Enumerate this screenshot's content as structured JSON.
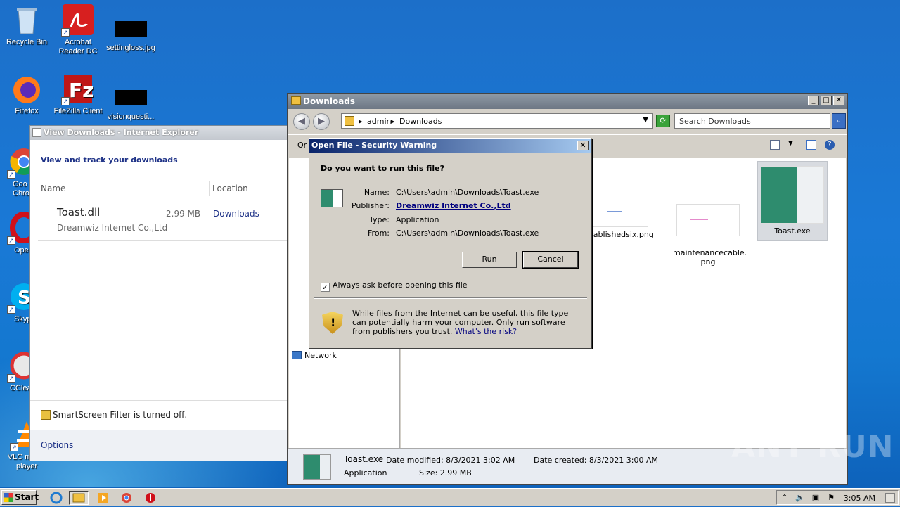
{
  "desktop": {
    "icons": [
      {
        "label": "Recycle Bin"
      },
      {
        "label": "Acrobat Reader DC"
      },
      {
        "label": "settingloss.jpg"
      },
      {
        "label": "Firefox"
      },
      {
        "label": "FileZilla Client"
      },
      {
        "label": "visionquesti..."
      },
      {
        "label": "Goo Chro"
      },
      {
        "label": "Ope"
      },
      {
        "label": "Skyp"
      },
      {
        "label": "CClea"
      },
      {
        "label": "VLC media player"
      }
    ]
  },
  "ie_window": {
    "title": "View Downloads - Internet Explorer",
    "heading": "View and track your downloads",
    "col_name": "Name",
    "col_location": "Location",
    "item": {
      "name": "Toast.dll",
      "size": "2.99 MB",
      "location": "Downloads",
      "publisher": "Dreamwiz Internet Co.,Ltd"
    },
    "smartscreen": "SmartScreen Filter is turned off.",
    "options": "Options"
  },
  "explorer": {
    "title": "Downloads",
    "breadcrumb": [
      "admin",
      "Downloads"
    ],
    "search_placeholder": "Search Downloads",
    "organize_partial": "Or",
    "network": "Network",
    "files": [
      {
        "name": "establishedsix.png"
      },
      {
        "name": "maintenancecable.\npng"
      },
      {
        "name": "Toast.exe"
      }
    ],
    "details": {
      "name": "Toast.exe",
      "modified": "Date modified: 8/3/2021 3:02 AM",
      "created": "Date created: 8/3/2021 3:00 AM",
      "type": "Application",
      "size": "Size: 2.99 MB"
    }
  },
  "dialog": {
    "title": "Open File - Security Warning",
    "question": "Do you want to run this file?",
    "labels": {
      "name": "Name:",
      "publisher": "Publisher:",
      "type": "Type:",
      "from": "From:"
    },
    "values": {
      "name": "C:\\Users\\admin\\Downloads\\Toast.exe",
      "publisher": "Dreamwiz Internet Co.,Ltd",
      "type": "Application",
      "from": "C:\\Users\\admin\\Downloads\\Toast.exe"
    },
    "run": "Run",
    "cancel": "Cancel",
    "checkbox": "Always ask before opening this file",
    "checkbox_checked": true,
    "warning": "While files from the Internet can be useful, this file type can potentially harm your computer. Only run software from publishers you trust.",
    "risk_link": "What's the risk?"
  },
  "taskbar": {
    "start": "Start",
    "time": "3:05 AM"
  },
  "watermark": "ANY RUN"
}
